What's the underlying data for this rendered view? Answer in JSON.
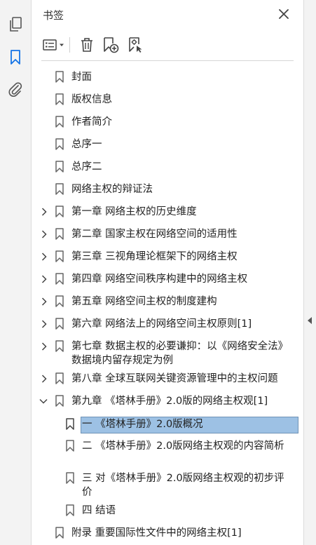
{
  "panel": {
    "title": "书签"
  },
  "rail": {
    "items": [
      "pages-icon",
      "bookmarks-icon",
      "attachments-icon"
    ]
  },
  "toolbar": {
    "options": "options-menu-icon",
    "delete": "trash-icon",
    "new_bookmark": "new-bookmark-icon",
    "new_from_structure": "bookmark-structure-icon"
  },
  "colors": {
    "selection": "#9dc1e4",
    "accent": "#1473e6"
  },
  "bookmarks": [
    {
      "label": "封面"
    },
    {
      "label": "版权信息"
    },
    {
      "label": "作者简介"
    },
    {
      "label": "总序一"
    },
    {
      "label": "总序二"
    },
    {
      "label": "网络主权的辩证法"
    },
    {
      "label": "第一章 网络主权的历史维度"
    },
    {
      "label": "第二章 国家主权在网络空间的适用性"
    },
    {
      "label": "第三章 三视角理论框架下的网络主权"
    },
    {
      "label": "第四章 网络空间秩序构建中的网络主权"
    },
    {
      "label": "第五章 网络空间主权的制度建构"
    },
    {
      "label": "第六章 网络法上的网络空间主权原则[1]"
    },
    {
      "label": "第七章 数据主权的必要谦抑：以《网络安全法》数据境内留存规定为例"
    },
    {
      "label": "第八章 全球互联网关键资源管理中的主权问题"
    },
    {
      "label": "第九章 《塔林手册》2.0版的网络主权观[1]"
    },
    {
      "label": "一 《塔林手册》2.0版概况"
    },
    {
      "label": "二 《塔林手册》2.0版网络主权观的内容简析"
    },
    {
      "label": "三 对《塔林手册》2.0版网络主权观的初步评价"
    },
    {
      "label": "四 结语"
    },
    {
      "label": "附录 重要国际性文件中的网络主权[1]"
    }
  ]
}
